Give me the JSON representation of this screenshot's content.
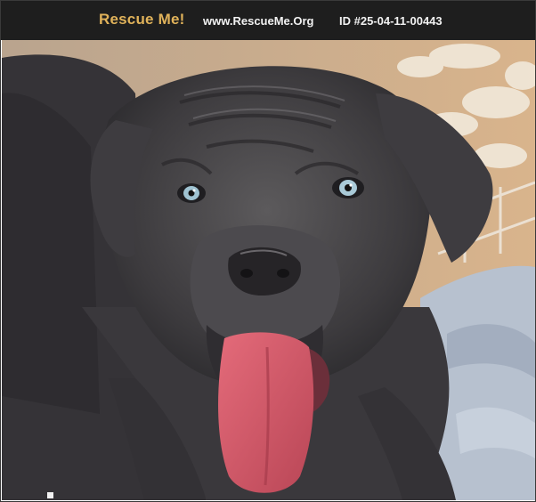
{
  "header": {
    "logo_text": "Rescue Me!",
    "site_url": "www.RescueMe.Org",
    "pet_id": "ID #25-04-11-00443"
  },
  "colors": {
    "header_bg": "#1e1e1e",
    "logo": "#e0b25a",
    "header_text": "#f2f2f2"
  },
  "photo": {
    "subject": "grey-puppy-photo"
  }
}
